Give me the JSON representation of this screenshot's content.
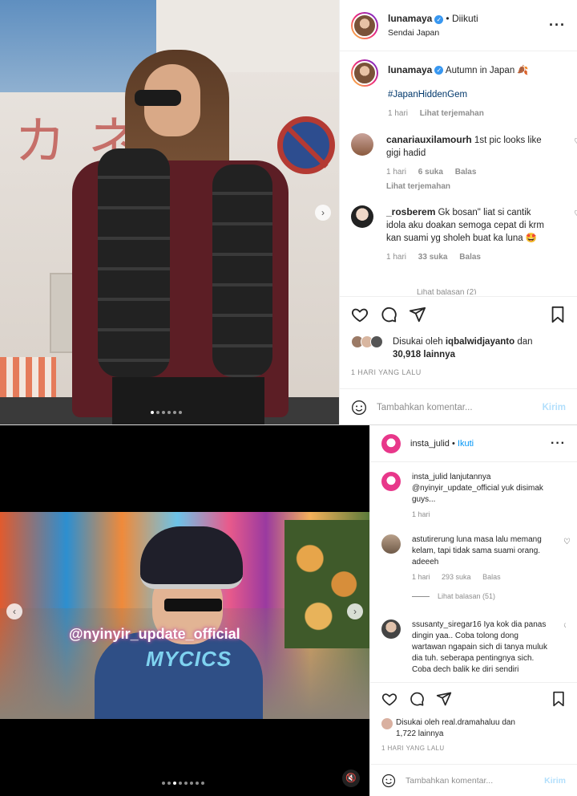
{
  "post1": {
    "username": "lunamaya",
    "follow_state": "Diikuti",
    "location": "Sendai Japan",
    "caption": {
      "username": "lunamaya",
      "text": "Autumn in Japan 🍂",
      "hashtag": "#JapanHiddenGem",
      "time": "1 hari",
      "translate": "Lihat terjemahan"
    },
    "image_sign_text": "カネ",
    "comments": [
      {
        "username": "canariauxilamourh",
        "text": "1st pic looks like gigi hadid",
        "time": "1 hari",
        "likes": "6 suka",
        "reply": "Balas",
        "translate": "Lihat terjemahan"
      },
      {
        "username": "_rosberem",
        "text": "Gk bosan\" liat si cantik idola aku doakan semoga cepat di krm kan suami yg sholeh buat ka luna 🤩",
        "time": "1 hari",
        "likes": "33 suka",
        "reply": "Balas"
      }
    ],
    "cut_text": "Lihat balasan (2)",
    "likes_prefix": "Disukai oleh",
    "likes_user": "iqbalwidjayanto",
    "likes_and": "dan",
    "likes_count": "30,918 lainnya",
    "timestamp": "1 HARI YANG LALU",
    "add_comment_placeholder": "Tambahkan komentar...",
    "post_label": "Kirim",
    "carousel_total": 6,
    "carousel_active": 1
  },
  "post2": {
    "username": "insta_julid",
    "follow_label": "Ikuti",
    "caption": {
      "username": "insta_julid",
      "text": "lanjutannya @nyinyir_update_official yuk disimak guys...",
      "time": "1 hari"
    },
    "watermark": "@nyinyir_update_official",
    "logo_text": "MYCICS",
    "comments": [
      {
        "username": "astutirerung",
        "text": "luna masa lalu memang kelam, tapi tidak sama suami orang. adeeeh",
        "time": "1 hari",
        "likes": "293 suka",
        "reply": "Balas",
        "view_replies": "Lihat balasan (51)"
      },
      {
        "username": "ssusanty_siregar16",
        "text": "Iya kok dia panas dingin yaa.. Coba tolong dong wartawan ngapain sich di tanya muluk dia tuh. seberapa pentingnya sich. Coba dech balik ke diri sendiri"
      }
    ],
    "likes_prefix": "Disukai oleh",
    "likes_user": "real.dramahaluu",
    "likes_and": "dan",
    "likes_count": "1,722 lainnya",
    "timestamp": "1 HARI YANG LALU",
    "add_comment_placeholder": "Tambahkan komentar...",
    "post_label": "Kirim",
    "carousel_total": 8,
    "carousel_active": 3
  },
  "colors": {
    "link_blue": "#00376b",
    "follow_blue": "#0095f6",
    "verified_blue": "#3897f0",
    "muted": "#8e8e8e"
  }
}
